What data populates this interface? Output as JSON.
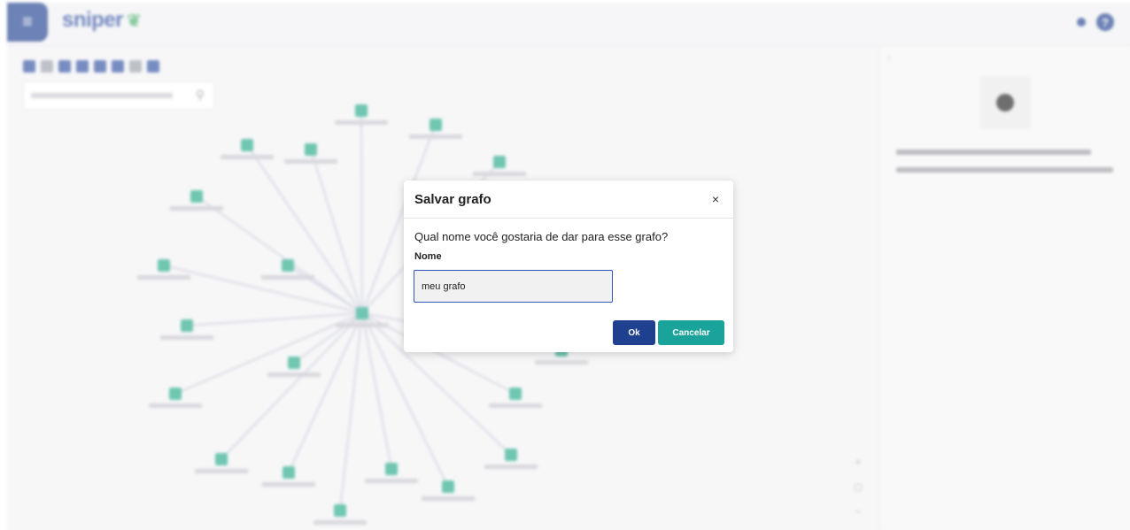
{
  "app": {
    "logo_text": "sniper"
  },
  "dialog": {
    "title": "Salvar grafo",
    "close_label": "×",
    "question": "Qual nome você gostaria de dar para esse grafo?",
    "field_label": "Nome",
    "input_value": "meu grafo",
    "ok_label": "Ok",
    "cancel_label": "Cancelar"
  },
  "colors": {
    "primary": "#1f3f8f",
    "accent": "#1aa39a",
    "node": "#22a887"
  }
}
